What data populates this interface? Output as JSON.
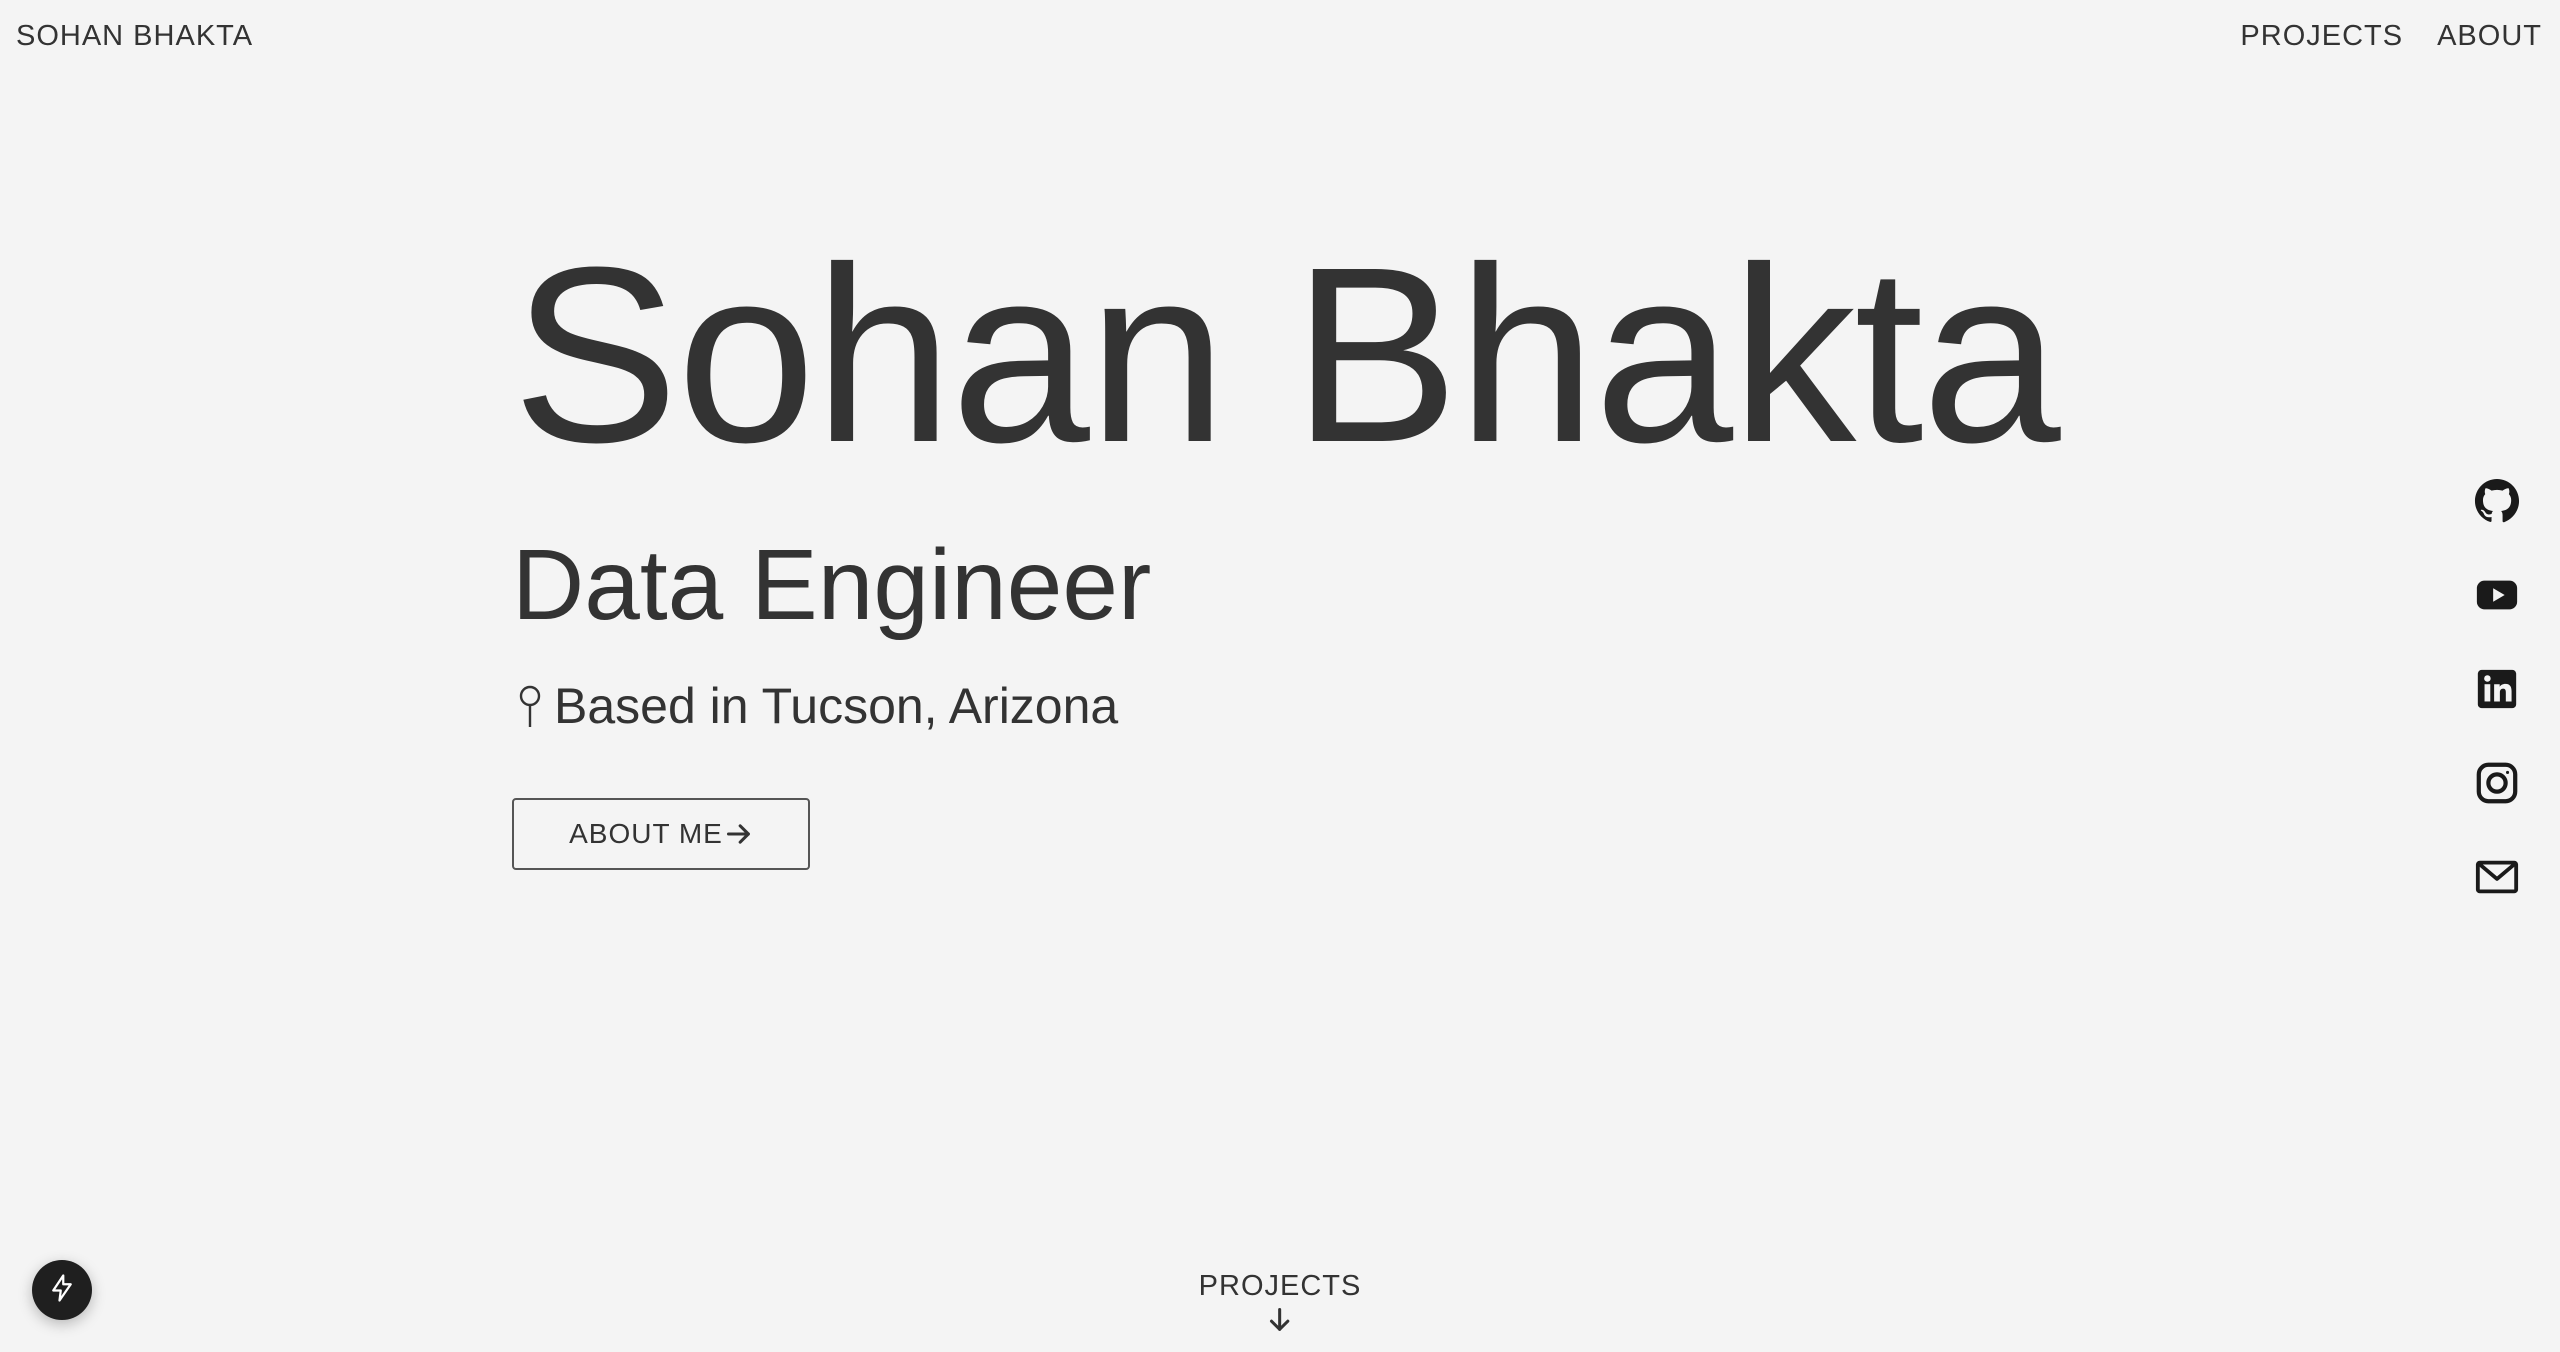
{
  "header": {
    "brand": "SOHAN BHAKTA",
    "nav": [
      {
        "label": "PROJECTS"
      },
      {
        "label": "ABOUT"
      }
    ]
  },
  "hero": {
    "name": "Sohan Bhakta",
    "role": "Data Engineer",
    "location_icon": "map-pin-icon",
    "location": "Based in Tucson, Arizona",
    "cta_label": "ABOUT ME",
    "cta_icon": "arrow-right-icon"
  },
  "social": [
    {
      "icon": "github-icon"
    },
    {
      "icon": "youtube-icon"
    },
    {
      "icon": "linkedin-icon"
    },
    {
      "icon": "instagram-icon"
    },
    {
      "icon": "mail-icon"
    }
  ],
  "footer_link": {
    "label": "PROJECTS",
    "icon": "arrow-down-icon"
  },
  "badge": {
    "icon": "lightning-icon"
  },
  "colors": {
    "background": "#f4f4f4",
    "text": "#333333",
    "icon": "#1a1a1a",
    "badge": "#1f1f1f"
  }
}
